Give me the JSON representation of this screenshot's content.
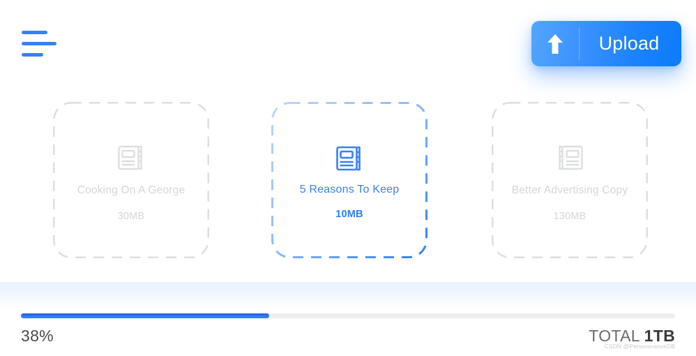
{
  "header": {
    "menu_icon": "hamburger-menu-icon",
    "upload": {
      "label": "Upload",
      "icon": "arrow-up-icon"
    }
  },
  "colors": {
    "accent": "#3780fb",
    "accent_dark": "#1b58d8",
    "inactive_text": "#d3d5d8",
    "inactive_border": "#d9dbdd",
    "track": "#efefef"
  },
  "files": [
    {
      "title": "Cooking On A George",
      "size": "30MB",
      "icon": "notebook-icon",
      "icon_mirrored": false,
      "selected": false
    },
    {
      "title": "5 Reasons To Keep",
      "size": "10MB",
      "icon": "notebook-icon",
      "icon_mirrored": false,
      "selected": true
    },
    {
      "title": "Better Advertising Copy",
      "size": "130MB",
      "icon": "notebook-icon",
      "icon_mirrored": true,
      "selected": false
    }
  ],
  "footer": {
    "progress_percent": 38,
    "percent_label": "38%",
    "total_prefix": "TOTAL ",
    "total_value": "1TB",
    "watermark": "CSDN @PerseveranceDB"
  }
}
